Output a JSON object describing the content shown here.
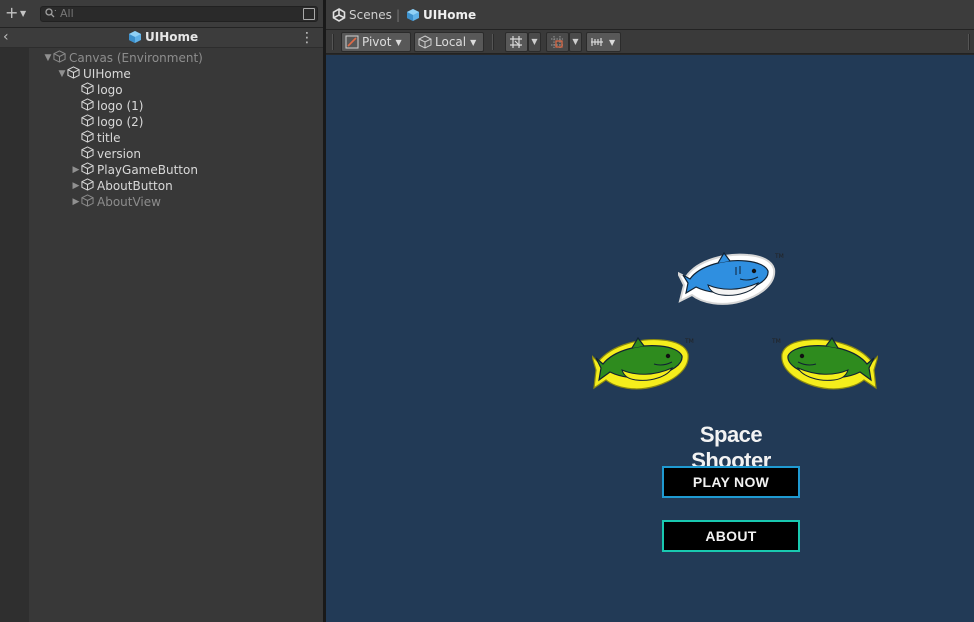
{
  "hierarchy": {
    "search": {
      "placeholder": "All"
    },
    "header": {
      "title": "UIHome"
    },
    "items": [
      {
        "label": "Canvas (Environment)",
        "depth": 0,
        "expander": "expanded",
        "dim": true
      },
      {
        "label": "UIHome",
        "depth": 1,
        "expander": "expanded",
        "dim": false
      },
      {
        "label": "logo",
        "depth": 2,
        "expander": "none",
        "dim": false
      },
      {
        "label": "logo (1)",
        "depth": 2,
        "expander": "none",
        "dim": false
      },
      {
        "label": "logo (2)",
        "depth": 2,
        "expander": "none",
        "dim": false
      },
      {
        "label": "title",
        "depth": 2,
        "expander": "none",
        "dim": false
      },
      {
        "label": "version",
        "depth": 2,
        "expander": "none",
        "dim": false
      },
      {
        "label": "PlayGameButton",
        "depth": 2,
        "expander": "collapsed",
        "dim": false
      },
      {
        "label": "AboutButton",
        "depth": 2,
        "expander": "collapsed",
        "dim": false
      },
      {
        "label": "AboutView",
        "depth": 2,
        "expander": "collapsed",
        "dim": true
      }
    ]
  },
  "scene": {
    "breadcrumb": {
      "scenes_label": "Scenes",
      "separator": "|",
      "current_label": "UIHome"
    },
    "toolbar": {
      "pivot_label": "Pivot",
      "local_label": "Local"
    },
    "game": {
      "title": "Space Shooter",
      "play_label": "PLAY NOW",
      "about_label": "ABOUT",
      "logo_tm": "TM",
      "colors": {
        "background": "#223a56",
        "play_border": "#1f9ad2",
        "about_border": "#19c9b0",
        "shark_blue": "#2f8fe0",
        "shark_green": "#2e8b1e",
        "logo_outline": "#f5ee1c"
      }
    }
  },
  "icons": [
    "plus-icon",
    "search-icon",
    "gameobject-cube-icon",
    "unity-logo-icon",
    "more-vert-icon",
    "pivot-icon",
    "grid-snap-icon",
    "increment-snap-icon",
    "ruler-icon"
  ]
}
